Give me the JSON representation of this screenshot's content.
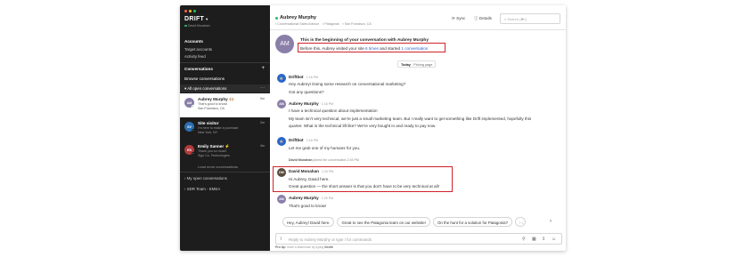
{
  "colors": {
    "sidebar_bg": "#1d1d1d",
    "highlight_border": "#d0222a",
    "online": "#2fb86e",
    "link": "#2a66c9"
  },
  "sidebar": {
    "brand": "DRIFT",
    "status": "David Monahan",
    "accounts_heading": "Accounts",
    "accounts_links": [
      "Target accounts",
      "Activity feed"
    ],
    "conversations_heading": "Conversations",
    "browse_label": "Browse conversations",
    "open_group": "All open conversations",
    "conversations": [
      {
        "initials": "AM",
        "name": "Aubrey Murphy",
        "emoji": "🙌🏼",
        "time": "9m",
        "line1": "That's good to know!",
        "line2": "San Francisco, CA",
        "color": "#8a7fa8"
      },
      {
        "initials": "SV",
        "name": "Site visitor",
        "emoji": "",
        "time": "2m",
        "line1": "I'm here to make a purchase",
        "line2": "New York, NY",
        "color": "#2b6fb3"
      },
      {
        "initials": "ES",
        "name": "Emily Sanner",
        "emoji": "⚡",
        "time": "4m",
        "line1": "Thank you so much!",
        "line2": "Sign Co. Technologies",
        "color": "#b23b3b"
      }
    ],
    "load_more": "Load more conversations",
    "groups": [
      "My open conversations",
      "SDR Team - EMEA"
    ]
  },
  "header": {
    "name": "Aubrey Murphy",
    "meta": [
      "Conversational Sales Advisor",
      "Patagonia",
      "San Francisco, CA"
    ],
    "sync_label": "Sync",
    "details_label": "Details",
    "search_placeholder": "Search (⌘K)"
  },
  "intro": {
    "initials": "AM",
    "title": "This is the beginning of your conversation with Aubrey Murphy",
    "text_before": "Before this, Aubrey visited your site",
    "times": "6 times",
    "text_mid": "and started",
    "conv_count": "1 conversation"
  },
  "divider": {
    "label": "Today",
    "page": "Pricing page"
  },
  "messages": [
    {
      "author": "Driftbot",
      "time": "1:16 PM",
      "lines": [
        "Hey Aubrey! Doing some research on conversational marketing?",
        "Got any questions?"
      ]
    },
    {
      "author": "Aubrey Murphy",
      "time": "1:16 PM",
      "lines": [
        "I have a technical question about implementation",
        "My team isn't very technical, we're just a small marketing team. But I really want to get something like Drift implemented, hopefully this",
        "quarter. What is the technical lift like? We're very bought in and ready to pay now."
      ]
    },
    {
      "author": "Driftbot",
      "time": "1:16 PM",
      "lines": [
        "Let me grab one of my humans for you."
      ]
    },
    {
      "author": "David Monahan",
      "time": "1:20 PM",
      "lines": [
        "Hi Aubrey, David here.",
        "Great question — the short answer is that you don't have to be very technical at all!"
      ]
    },
    {
      "author": "Aubrey Murphy",
      "time": "1:20 PM",
      "lines": [
        "That's good to know!"
      ]
    }
  ],
  "system": {
    "name": "David Monahan",
    "text": "joined the conversation",
    "time": "2:45 PM"
  },
  "chips": [
    "Hey, Aubrey! David here.",
    "Great to see the Patagonia team on our website!",
    "On the hunt for a solution for Patagonia?",
    "I c"
  ],
  "composer": {
    "placeholder": "Reply to Aubrey Murphy or type / for commands",
    "protip_label": "Pro tip:",
    "protip_text": "Invite a teammate by typing",
    "protip_cmd": "/invite"
  }
}
